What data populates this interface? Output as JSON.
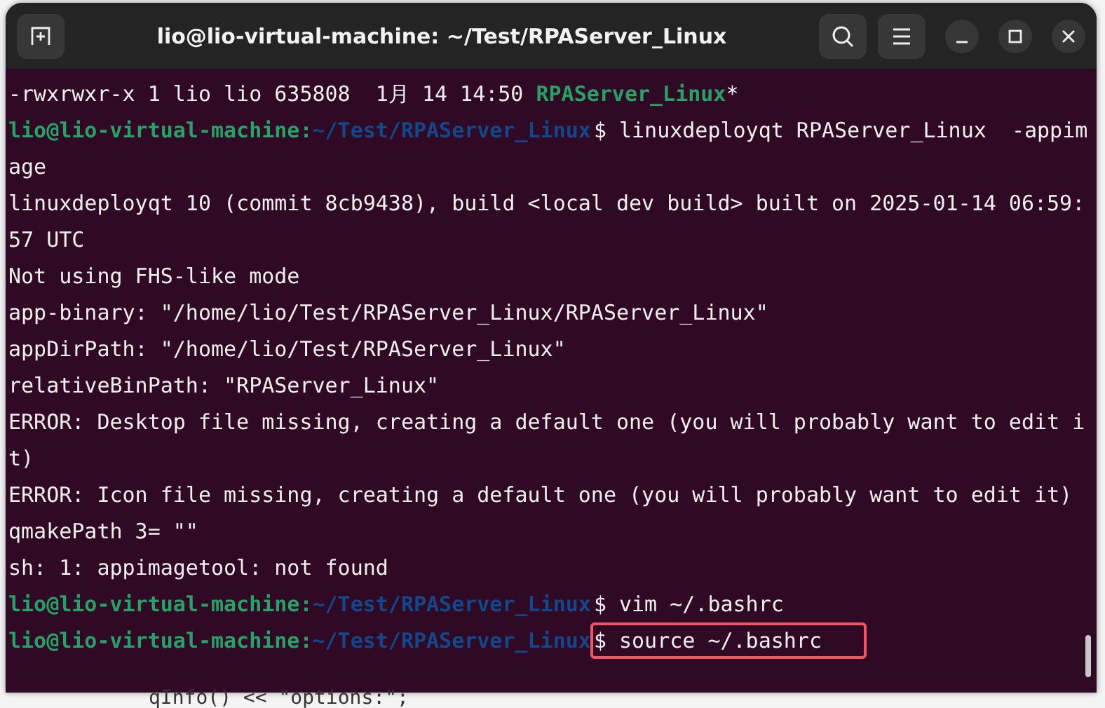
{
  "window": {
    "title": "lio@lio-virtual-machine: ~/Test/RPAServer_Linux"
  },
  "terminal": {
    "rows": [
      {
        "kind": "listing",
        "text": "-rwxrwxr-x 1 lio lio 635808  1月 14 14:50 ",
        "file": "RPAServer_Linux",
        "suffix": "*"
      },
      {
        "kind": "prompt",
        "user": "lio@lio-virtual-machine:",
        "path": "~/Test/RPAServer_Linux",
        "command": "$ linuxdeployqt RPAServer_Linux  -appim",
        "highlighted": false
      },
      {
        "kind": "output",
        "text": "age"
      },
      {
        "kind": "output",
        "text": "linuxdeployqt 10 (commit 8cb9438), build <local dev build> built on 2025-01-14 06:59:"
      },
      {
        "kind": "output",
        "text": "57 UTC"
      },
      {
        "kind": "output",
        "text": "Not using FHS-like mode"
      },
      {
        "kind": "output",
        "text": "app-binary: \"/home/lio/Test/RPAServer_Linux/RPAServer_Linux\""
      },
      {
        "kind": "output",
        "text": "appDirPath: \"/home/lio/Test/RPAServer_Linux\""
      },
      {
        "kind": "output",
        "text": "relativeBinPath: \"RPAServer_Linux\""
      },
      {
        "kind": "output",
        "text": "ERROR: Desktop file missing, creating a default one (you will probably want to edit i"
      },
      {
        "kind": "output",
        "text": "t)"
      },
      {
        "kind": "output",
        "text": "ERROR: Icon file missing, creating a default one (you will probably want to edit it)"
      },
      {
        "kind": "output",
        "text": "qmakePath 3= \"\""
      },
      {
        "kind": "output",
        "text": "sh: 1: appimagetool: not found"
      },
      {
        "kind": "prompt",
        "user": "lio@lio-virtual-machine:",
        "path": "~/Test/RPAServer_Linux",
        "command": "$ vim ~/.bashrc",
        "highlighted": false
      },
      {
        "kind": "prompt",
        "user": "lio@lio-virtual-machine:",
        "path": "~/Test/RPAServer_Linux",
        "command": "$ source ~/.bashrc",
        "highlighted": true
      }
    ]
  },
  "background_code": "qInfo() << \"options:\";"
}
